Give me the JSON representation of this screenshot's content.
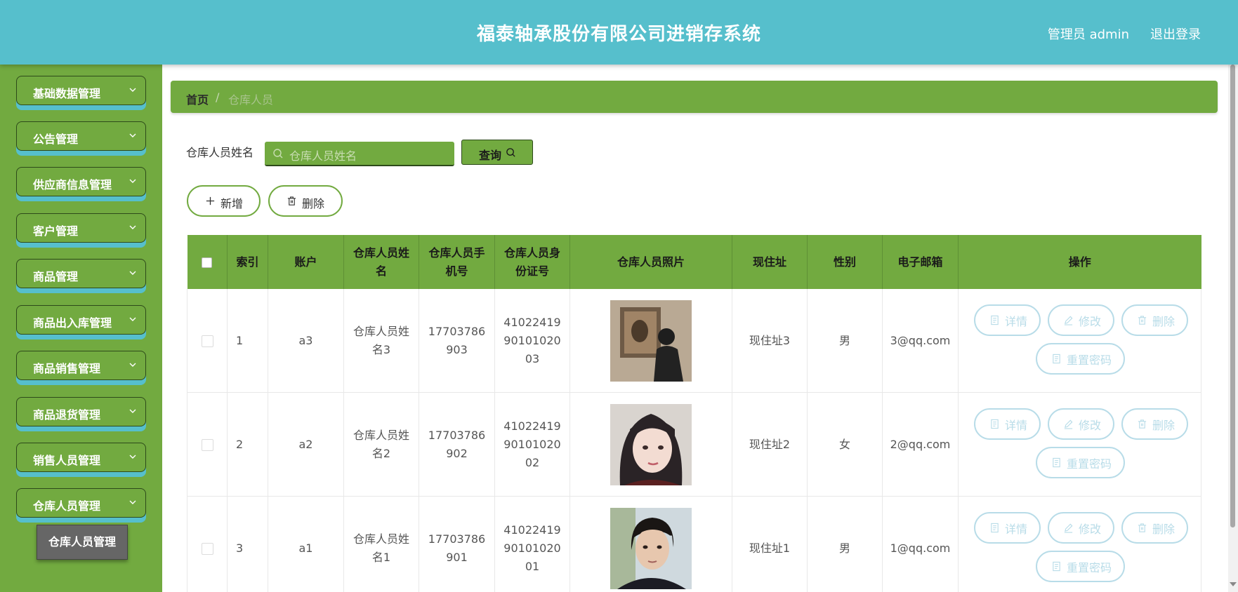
{
  "header": {
    "title": "福泰轴承股份有限公司进销存系统",
    "user": "管理员 admin",
    "logout": "退出登录"
  },
  "sidebar": {
    "items": [
      {
        "label": "基础数据管理"
      },
      {
        "label": "公告管理"
      },
      {
        "label": "供应商信息管理"
      },
      {
        "label": "客户管理"
      },
      {
        "label": "商品管理"
      },
      {
        "label": "商品出入库管理"
      },
      {
        "label": "商品销售管理"
      },
      {
        "label": "商品退货管理"
      },
      {
        "label": "销售人员管理"
      },
      {
        "label": "仓库人员管理"
      }
    ],
    "submenu": "仓库人员管理"
  },
  "breadcrumb": {
    "home": "首页",
    "separator": "/",
    "current": "仓库人员"
  },
  "search": {
    "label": "仓库人员姓名",
    "placeholder": "仓库人员姓名",
    "button": "查询"
  },
  "actions": {
    "add": "新增",
    "delete": "删除"
  },
  "table": {
    "headers": {
      "index": "索引",
      "account": "账户",
      "name": "仓库人员姓名",
      "phone": "仓库人员手机号",
      "idcard": "仓库人员身份证号",
      "photo": "仓库人员照片",
      "address": "现住址",
      "gender": "性别",
      "email": "电子邮箱",
      "ops": "操作"
    },
    "rows": [
      {
        "index": "1",
        "account": "a3",
        "name": "仓库人员姓名3",
        "phone": "17703786903",
        "idcard": "410224199010102003",
        "address": "现住址3",
        "gender": "男",
        "email": "3@qq.com"
      },
      {
        "index": "2",
        "account": "a2",
        "name": "仓库人员姓名2",
        "phone": "17703786902",
        "idcard": "410224199010102002",
        "address": "现住址2",
        "gender": "女",
        "email": "2@qq.com"
      },
      {
        "index": "3",
        "account": "a1",
        "name": "仓库人员姓名1",
        "phone": "17703786901",
        "idcard": "410224199010102001",
        "address": "现住址1",
        "gender": "男",
        "email": "1@qq.com"
      }
    ],
    "ops": {
      "detail": "详情",
      "edit": "修改",
      "delete": "删除",
      "reset": "重置密码"
    }
  },
  "colors": {
    "header": "#56bfcc",
    "sidebar": "#72aa40",
    "menu_shadow": "#56bfcc",
    "op_button": "#b8dce8"
  }
}
